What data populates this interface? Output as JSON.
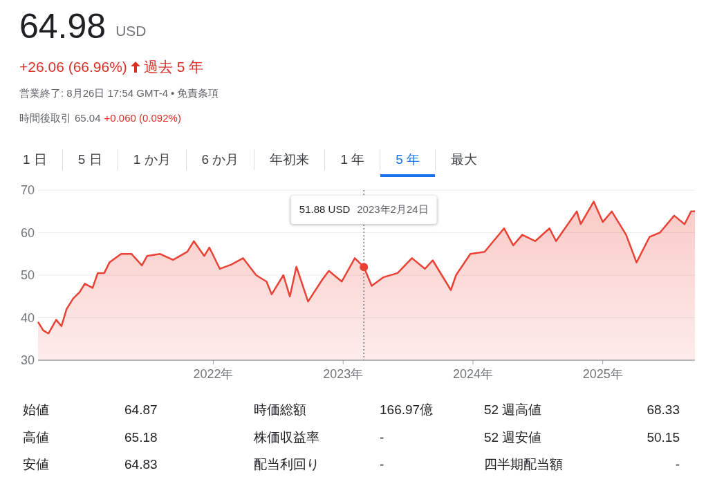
{
  "quote": {
    "price": "64.98",
    "currency": "USD",
    "change": "+26.06 (66.96%)",
    "period": "過去 5 年",
    "status": "営業終了: 8月26日 17:54 GMT-4",
    "separator": "•",
    "disclaimer": "免責条項",
    "after_hours_label": "時間後取引",
    "after_hours_price": "65.04",
    "after_hours_change": "+0.060 (0.092%)"
  },
  "tabs": [
    {
      "label": "1 日",
      "selected": false
    },
    {
      "label": "5 日",
      "selected": false
    },
    {
      "label": "1 か月",
      "selected": false
    },
    {
      "label": "6 か月",
      "selected": false
    },
    {
      "label": "年初来",
      "selected": false
    },
    {
      "label": "1 年",
      "selected": false
    },
    {
      "label": "5 年",
      "selected": true
    },
    {
      "label": "最大",
      "selected": false
    }
  ],
  "chart": {
    "tooltip": {
      "price": "51.88 USD",
      "date": "2023年2月24日"
    },
    "chart_data": {
      "type": "area",
      "grid": true,
      "xlim": [
        2020.65,
        2025.71
      ],
      "ylim": [
        30,
        70
      ],
      "yticks": [
        30,
        40,
        50,
        60,
        70
      ],
      "xticks": [
        {
          "value": 2022,
          "label": "2022年"
        },
        {
          "value": 2023,
          "label": "2023年"
        },
        {
          "value": 2024,
          "label": "2024年"
        },
        {
          "value": 2025,
          "label": "2025年"
        }
      ],
      "x": [
        2020.65,
        2020.69,
        2020.73,
        2020.79,
        2020.83,
        2020.87,
        2020.92,
        2020.97,
        2021.01,
        2021.07,
        2021.11,
        2021.16,
        2021.2,
        2021.29,
        2021.37,
        2021.45,
        2021.49,
        2021.59,
        2021.69,
        2021.8,
        2021.85,
        2021.93,
        2021.97,
        2022.05,
        2022.14,
        2022.23,
        2022.33,
        2022.41,
        2022.45,
        2022.54,
        2022.59,
        2022.64,
        2022.73,
        2022.84,
        2022.89,
        2022.99,
        2023.09,
        2023.16,
        2023.22,
        2023.31,
        2023.42,
        2023.53,
        2023.63,
        2023.69,
        2023.83,
        2023.87,
        2023.98,
        2024.09,
        2024.24,
        2024.31,
        2024.38,
        2024.48,
        2024.59,
        2024.64,
        2024.8,
        2024.83,
        2024.93,
        2025.0,
        2025.07,
        2025.18,
        2025.26,
        2025.36,
        2025.44,
        2025.55,
        2025.63,
        2025.68,
        2025.71
      ],
      "series": [
        {
          "color": "#e94235",
          "values": [
            39,
            37,
            36.3,
            39.5,
            38,
            42,
            44.5,
            46,
            48,
            47,
            50.5,
            50.5,
            53,
            55,
            55,
            52.3,
            54.5,
            55,
            53.6,
            55.5,
            58,
            54.5,
            56.5,
            51.5,
            52.5,
            54,
            50,
            48.5,
            45.5,
            50,
            45,
            52,
            43.8,
            49,
            51,
            48.5,
            54,
            51.9,
            47.5,
            49.5,
            50.5,
            54,
            51.5,
            53.5,
            46.5,
            50,
            55,
            55.5,
            61,
            57,
            59.5,
            58,
            61,
            58,
            65,
            62,
            67.3,
            62.5,
            65,
            59.5,
            53,
            59,
            60,
            64,
            62,
            65,
            65
          ]
        }
      ],
      "ref_lines": [
        {
          "axis": "x",
          "value": 2023.16
        }
      ]
    }
  },
  "stats": [
    {
      "label": "始値",
      "value": "64.87"
    },
    {
      "label": "時価総額",
      "value": "166.97億"
    },
    {
      "label": "52 週高値",
      "value": "68.33"
    },
    {
      "label": "高値",
      "value": "65.18"
    },
    {
      "label": "株価収益率",
      "value": "-"
    },
    {
      "label": "52 週安値",
      "value": "50.15"
    },
    {
      "label": "安値",
      "value": "64.83"
    },
    {
      "label": "配当利回り",
      "value": "-"
    },
    {
      "label": "四半期配当額",
      "value": "-"
    }
  ]
}
